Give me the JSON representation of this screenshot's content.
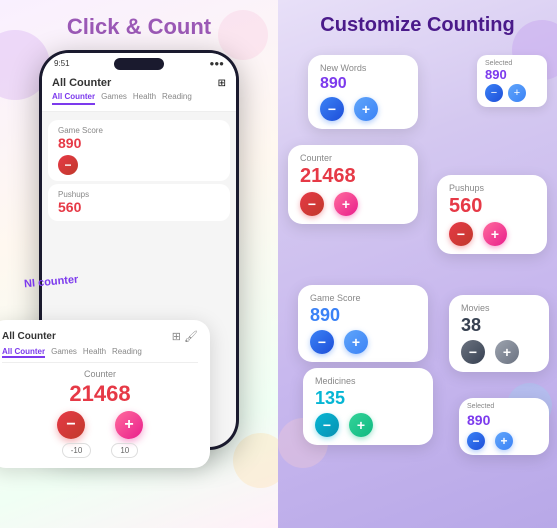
{
  "left": {
    "title": "Click & Count",
    "phone": {
      "status_time": "9:51",
      "app_title": "All Counter",
      "tabs": [
        "All Counter",
        "Games",
        "Health",
        "Reading"
      ],
      "active_tab": "All Counter"
    },
    "card": {
      "title": "All Counter",
      "tabs": [
        "All Counter",
        "Games",
        "Health",
        "Reading"
      ],
      "active_tab": "All Counter",
      "counter_label": "Counter",
      "counter_value": "21468",
      "minus_label": "−",
      "plus_label": "+",
      "step_minus": "-10",
      "step_plus": "10"
    },
    "mini_cards": [
      {
        "label": "Game Score",
        "value": "890"
      },
      {
        "label": "Pushups",
        "value": "560"
      }
    ]
  },
  "right": {
    "title": "Customize Counting",
    "cards": [
      {
        "id": "new-words",
        "label": "New Words",
        "value": "890",
        "style": "purple"
      },
      {
        "id": "counter",
        "label": "Counter",
        "value": "21468",
        "style": "red"
      },
      {
        "id": "pushups",
        "label": "Pushups",
        "value": "560",
        "style": "red"
      },
      {
        "id": "game-score",
        "label": "Game Score",
        "value": "890",
        "style": "blue"
      },
      {
        "id": "medicines",
        "label": "Medicines",
        "value": "135",
        "style": "teal"
      },
      {
        "id": "movies",
        "label": "Movies",
        "value": "38",
        "style": "dark"
      }
    ],
    "small_card": {
      "label": "Selected",
      "value": "890"
    }
  },
  "ni_counter": "NI counter",
  "icons": {
    "qr": "⊞",
    "minus": "−",
    "plus": "+"
  }
}
